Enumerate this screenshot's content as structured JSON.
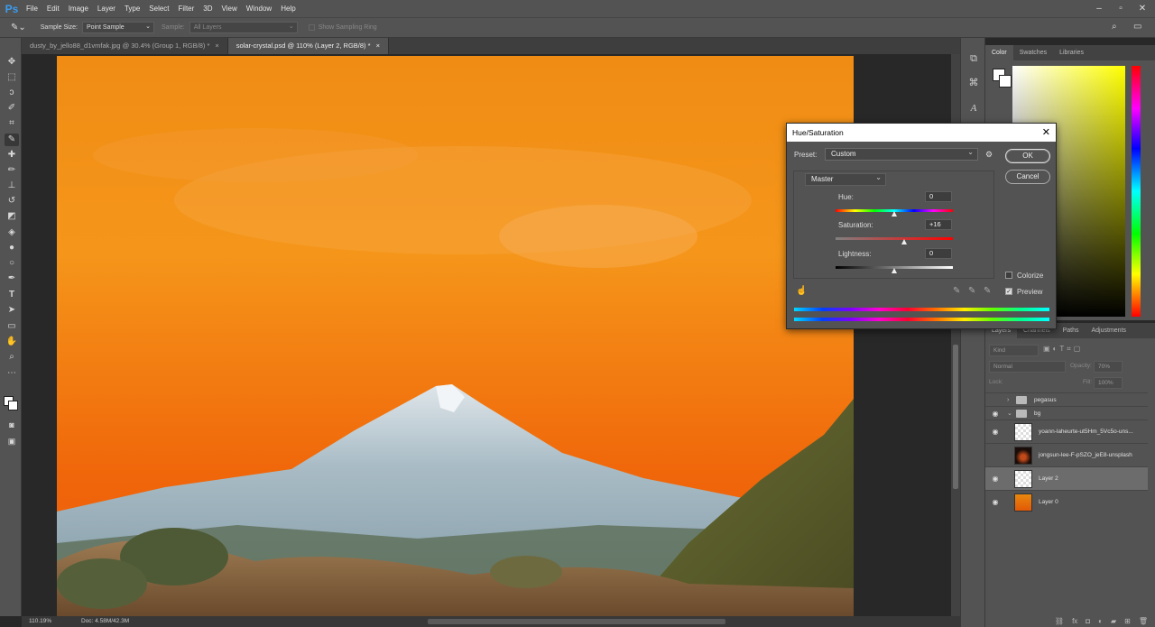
{
  "menu": {
    "logo": "Ps",
    "items": [
      "File",
      "Edit",
      "Image",
      "Layer",
      "Type",
      "Select",
      "Filter",
      "3D",
      "View",
      "Window",
      "Help"
    ]
  },
  "options": {
    "sample_size_label": "Sample Size:",
    "sample_size_value": "Point Sample",
    "sample_label": "Sample:",
    "sample_value": "All Layers",
    "show_ring_label": "Show Sampling Ring"
  },
  "tabs": [
    {
      "label": "dusty_by_jello88_d1vmfak.jpg @ 30.4% (Group 1, RGB/8) *"
    },
    {
      "label": "solar-crystal.psd @ 110% (Layer 2, RGB/8) *"
    }
  ],
  "status": {
    "zoom": "110.19%",
    "doc": "Doc: 4.58M/42.3M"
  },
  "color_panel": {
    "tabs": [
      "Color",
      "Swatches",
      "Libraries"
    ]
  },
  "layers_panel": {
    "tabs": [
      "Layers",
      "Channels",
      "Paths",
      "Adjustments"
    ],
    "kind_placeholder": "Kind",
    "blend_mode": "Normal",
    "opacity_label": "Opacity:",
    "opacity_value": "70%",
    "lock_label": "Lock:",
    "fill_label": "Fill:",
    "fill_value": "100%",
    "layers": [
      {
        "name": "pegasus",
        "type": "group"
      },
      {
        "name": "bg",
        "type": "group"
      },
      {
        "name": "yoann-laheurte-ut5Hm_5Vc5o-uns...",
        "type": "layer"
      },
      {
        "name": "jongsun-lee-F-pSZO_jeE8-unsplash",
        "type": "layer"
      },
      {
        "name": "Layer 2",
        "type": "layer"
      },
      {
        "name": "Layer 0",
        "type": "layer"
      }
    ]
  },
  "dialog": {
    "title": "Hue/Saturation",
    "preset_label": "Preset:",
    "preset_value": "Custom",
    "ok_label": "OK",
    "cancel_label": "Cancel",
    "channel": "Master",
    "hue_label": "Hue:",
    "hue_value": "0",
    "saturation_label": "Saturation:",
    "saturation_value": "+16",
    "lightness_label": "Lightness:",
    "lightness_value": "0",
    "colorize_label": "Colorize",
    "preview_label": "Preview",
    "colorize_checked": false,
    "preview_checked": true
  }
}
